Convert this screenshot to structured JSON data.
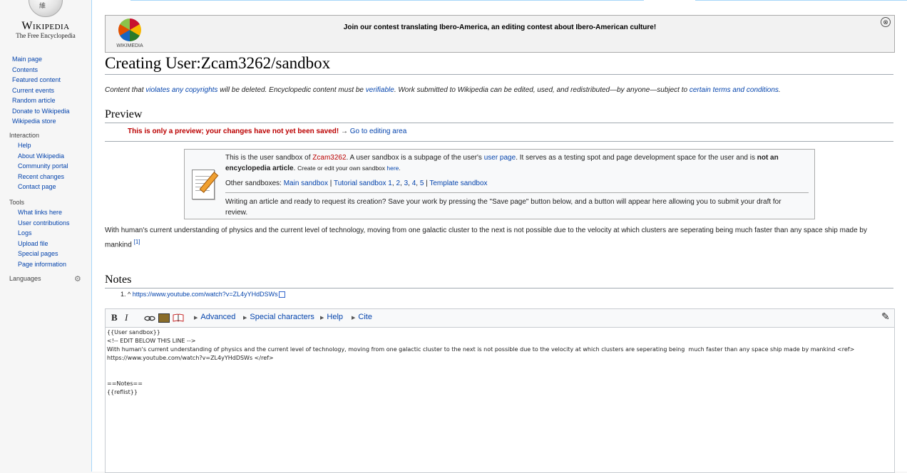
{
  "logo": {
    "wordmark": "Wikipedia",
    "tagline": "The Free Encyclopedia",
    "glyph": "維"
  },
  "sidebar": {
    "main": [
      "Main page",
      "Contents",
      "Featured content",
      "Current events",
      "Random article",
      "Donate to Wikipedia",
      "Wikipedia store"
    ],
    "interaction_head": "Interaction",
    "interaction": [
      "Help",
      "About Wikipedia",
      "Community portal",
      "Recent changes",
      "Contact page"
    ],
    "tools_head": "Tools",
    "tools": [
      "What links here",
      "User contributions",
      "Logs",
      "Upload file",
      "Special pages",
      "Page information"
    ],
    "languages_head": "Languages"
  },
  "banner": {
    "logo_text": "WIKIMEDIA",
    "message": "Join our contest translating Ibero-America, an editing contest about Ibero-American culture!",
    "close_icon": "⊗"
  },
  "page": {
    "title": "Creating User:Zcam3262/sandbox",
    "copyright": {
      "p1": "Content that ",
      "l1": "violates any copyrights",
      "p2": " will be deleted. Encyclopedic content must be ",
      "l2": "verifiable",
      "p3": ". Work submitted to Wikipedia can be edited, used, and redistributed—by anyone—subject to ",
      "l3": "certain terms and conditions",
      "p4": "."
    },
    "preview_heading": "Preview",
    "warning": "This is only a preview; your changes have not yet been saved!",
    "warning_arrow": "→",
    "goto_link": "Go to editing area"
  },
  "sandbox_box": {
    "t1": "This is the user sandbox of ",
    "user": "Zcam3262",
    "t2": ". A user sandbox is a subpage of the user's ",
    "userpage": "user page",
    "t3": ". It serves as a testing spot and page development space for the user and is ",
    "bold": "not an encyclopedia article",
    "t4": ". ",
    "small": "Create or edit your own sandbox ",
    "here": "here",
    "t5": ".",
    "other_label": "Other sandboxes: ",
    "main_sandbox": "Main sandbox",
    "sep": " | ",
    "tutorial": "Tutorial sandbox 1",
    "t2n": "2",
    "t3n": "3",
    "t4n": "4",
    "t5n": "5",
    "template": "Template sandbox",
    "request": "Writing an article and ready to request its creation? Save your work by pressing the \"Save page\" button below, and a button will appear here allowing you to submit your draft for review."
  },
  "body_text": "With human's current understanding of physics and the current level of technology, moving from one galactic cluster to the next is not possible due to the velocity at which clusters are seperating being much faster than any space ship made by mankind",
  "body_ref": "[1]",
  "notes": {
    "heading": "Notes",
    "ref_num": "1. ^",
    "ref_url": "https://www.youtube.com/watch?v=ZL4yYHdDSWs"
  },
  "editor": {
    "bold": "B",
    "italic": "I",
    "advanced": "Advanced",
    "special": "Special characters",
    "help": "Help",
    "cite": "Cite",
    "pencil_icon": "✎",
    "wikitext": "{{User sandbox}}\n<!-- EDIT BELOW THIS LINE -->\nWith human's current understanding of physics and the current level of technology, moving from one galactic cluster to the next is not possible due to the velocity at which clusters are seperating being  much faster than any space ship made by mankind <ref>\nhttps://www.youtube.com/watch?v=ZL4yYHdDSWs </ref>\n\n\n==Notes==\n{{reflist}}"
  }
}
